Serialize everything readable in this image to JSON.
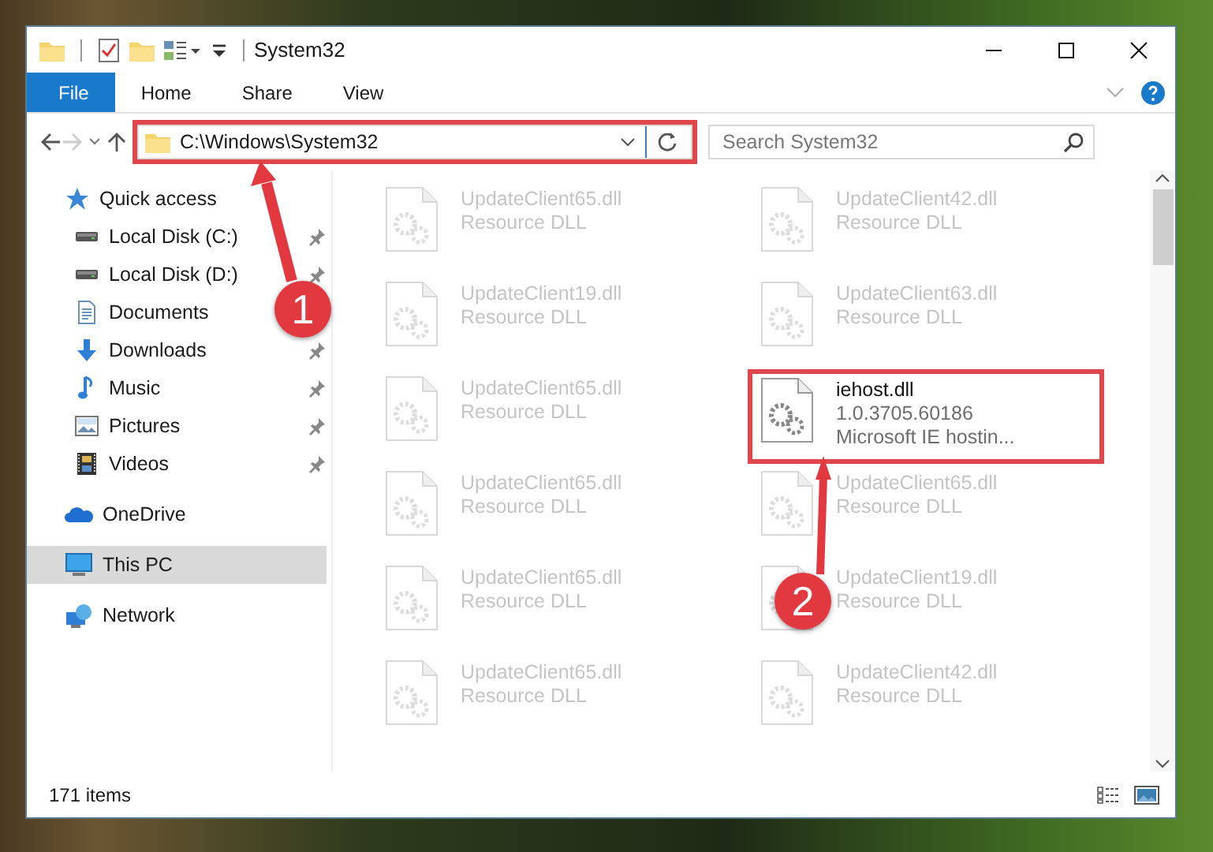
{
  "window": {
    "title": "System32"
  },
  "ribbon_tabs": [
    {
      "label": "File",
      "kind": "menu"
    },
    {
      "label": "Home",
      "kind": "tab"
    },
    {
      "label": "Share",
      "kind": "tab"
    },
    {
      "label": "View",
      "kind": "tab"
    }
  ],
  "address_bar": {
    "path": "C:\\Windows\\System32",
    "highlighted": true
  },
  "search": {
    "placeholder": "Search System32"
  },
  "navigation": [
    {
      "label": "Quick access",
      "kind": "star",
      "selected": false,
      "children": [
        {
          "label": "Local Disk (C:)",
          "kind": "drive",
          "pinned": true,
          "selected": false
        },
        {
          "label": "Local Disk (D:)",
          "kind": "drive",
          "pinned": true,
          "selected": false
        },
        {
          "label": "Documents",
          "kind": "documents",
          "selected": false
        },
        {
          "label": "Downloads",
          "kind": "downloads",
          "pinned": true,
          "selected": false
        },
        {
          "label": "Music",
          "kind": "music",
          "pinned": true,
          "selected": false
        },
        {
          "label": "Pictures",
          "kind": "pictures",
          "pinned": true,
          "selected": false
        },
        {
          "label": "Videos",
          "kind": "videos",
          "pinned": true,
          "selected": false
        }
      ]
    },
    {
      "label": "OneDrive",
      "kind": "cloud",
      "selected": false
    },
    {
      "label": "This PC",
      "kind": "pc",
      "selected": true
    },
    {
      "label": "Network",
      "kind": "network",
      "selected": false
    }
  ],
  "files": [
    {
      "name": "UpdateClient65.dll",
      "details": [
        "Resource DLL"
      ],
      "faded": true,
      "highlighted": false
    },
    {
      "name": "UpdateClient42.dll",
      "details": [
        "Resource DLL"
      ],
      "faded": true,
      "highlighted": false
    },
    {
      "name": "UpdateClient19.dll",
      "details": [
        "Resource DLL"
      ],
      "faded": true,
      "highlighted": false
    },
    {
      "name": "UpdateClient63.dll",
      "details": [
        "Resource DLL"
      ],
      "faded": true,
      "highlighted": false
    },
    {
      "name": "UpdateClient65.dll",
      "details": [
        "Resource DLL"
      ],
      "faded": true,
      "highlighted": false
    },
    {
      "name": "iehost.dll",
      "details": [
        "1.0.3705.60186",
        "Microsoft IE hostin..."
      ],
      "faded": false,
      "highlighted": true
    },
    {
      "name": "UpdateClient65.dll",
      "details": [
        "Resource DLL"
      ],
      "faded": true,
      "highlighted": false
    },
    {
      "name": "UpdateClient65.dll",
      "details": [
        "Resource DLL"
      ],
      "faded": true,
      "highlighted": false
    },
    {
      "name": "UpdateClient65.dll",
      "details": [
        "Resource DLL"
      ],
      "faded": true,
      "highlighted": false
    },
    {
      "name": "UpdateClient19.dll",
      "details": [
        "Resource DLL"
      ],
      "faded": true,
      "highlighted": false
    },
    {
      "name": "UpdateClient65.dll",
      "details": [
        "Resource DLL"
      ],
      "faded": true,
      "highlighted": false
    },
    {
      "name": "UpdateClient42.dll",
      "details": [
        "Resource DLL"
      ],
      "faded": true,
      "highlighted": false
    }
  ],
  "status_bar": {
    "item_count": "171 items"
  },
  "callouts": [
    {
      "number": "1"
    },
    {
      "number": "2"
    }
  ]
}
